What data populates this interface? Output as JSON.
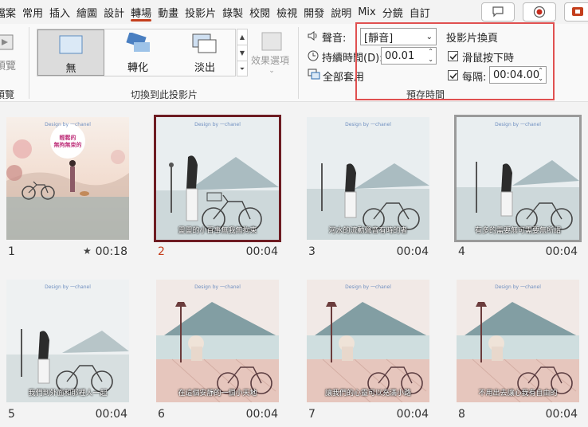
{
  "tabs": [
    "檔案",
    "常用",
    "插入",
    "繪圖",
    "設計",
    "轉場",
    "動畫",
    "投影片",
    "錄製",
    "校閱",
    "檢視",
    "開發",
    "說明",
    "Mix",
    "分鏡",
    "自訂"
  ],
  "active_tab": "轉場",
  "ribbon": {
    "preview_label": "預覽",
    "preview_group": "預覽",
    "gallery_items": [
      {
        "label": "無"
      },
      {
        "label": "轉化"
      },
      {
        "label": "淡出"
      }
    ],
    "effect_options": "效果選項",
    "transition_group": "切換到此投影片",
    "sound_label": "聲音:",
    "sound_value": "[靜音]",
    "duration_label": "持續時間(D):",
    "duration_value": "00.01",
    "apply_all": "全部套用",
    "advance_title": "投影片換頁",
    "on_click_label": "滑鼠按下時",
    "after_label": "每隔:",
    "after_value": "00:04.00",
    "timing_group": "預存時間"
  },
  "slides": [
    {
      "num": "1",
      "time": "00:18",
      "star": "★",
      "caption": "",
      "bubble": "輕鬆的\n無拘無束的"
    },
    {
      "num": "2",
      "time": "00:04",
      "caption": "靈靈的小百事無我無拘束"
    },
    {
      "num": "3",
      "time": "00:04",
      "caption": "河水的流動聲音有時的者"
    },
    {
      "num": "4",
      "time": "00:04",
      "caption": "有多的需要無可需要無所謂"
    },
    {
      "num": "5",
      "time": "00:04",
      "caption": "我們到外面和那裡人一起"
    },
    {
      "num": "6",
      "time": "00:04",
      "caption": "在這個安靜的一個小天地"
    },
    {
      "num": "7",
      "time": "00:04",
      "caption": "讓我們的心靈可以充滿小路"
    },
    {
      "num": "8",
      "time": "00:04",
      "caption": "不用出去讓心我有自由的"
    }
  ],
  "design_text": "Design by 一chanel"
}
